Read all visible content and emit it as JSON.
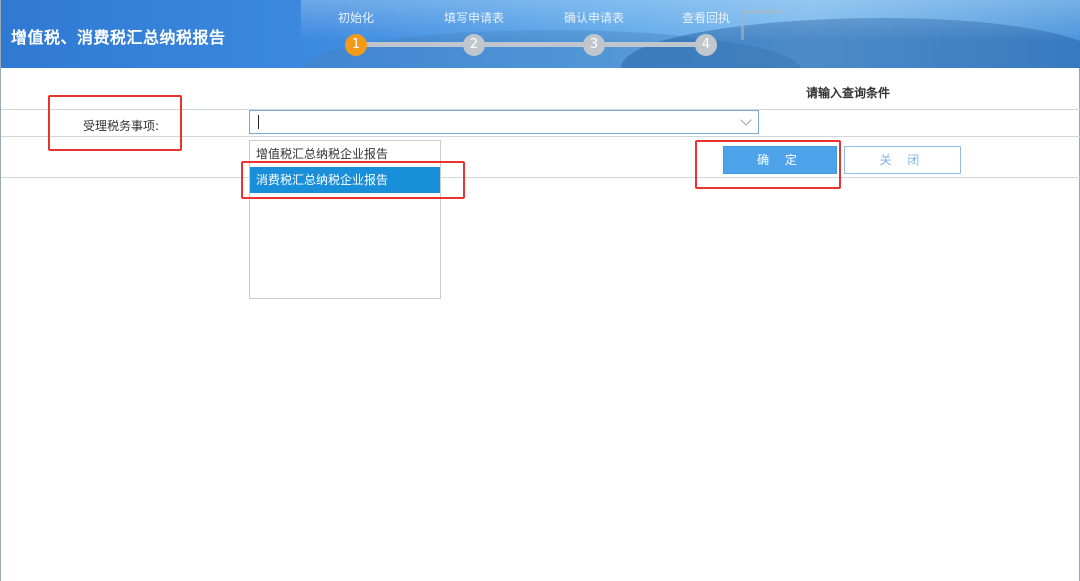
{
  "app_title": "增值税、消费税汇总纳税报告",
  "steps": [
    {
      "label": "初始化",
      "number": "1",
      "state": "active"
    },
    {
      "label": "填写申请表",
      "number": "2",
      "state": "pending"
    },
    {
      "label": "确认申请表",
      "number": "3",
      "state": "pending"
    },
    {
      "label": "查看回执",
      "number": "4",
      "state": "pending"
    }
  ],
  "query": {
    "heading": "请输入查询条件",
    "field_label": "受理税务事项:",
    "select_value": "",
    "options": [
      "增值税汇总纳税企业报告",
      "消费税汇总纳税企业报告"
    ],
    "selected_option_index": 1
  },
  "buttons": {
    "ok": "确 定",
    "close": "关 闭"
  },
  "colors": {
    "active_step": "#f39a1b",
    "selected_option": "#1a8fd9",
    "primary_button": "#4da3ea",
    "highlight": "#e8332f"
  }
}
